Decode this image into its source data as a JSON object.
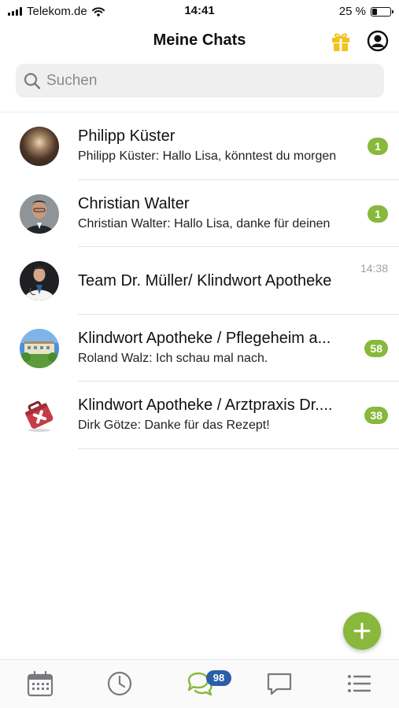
{
  "status_bar": {
    "carrier": "Telekom.de",
    "time": "14:41",
    "battery_percent_text": "25 %",
    "battery_level": 0.25
  },
  "header": {
    "title": "Meine Chats",
    "icons": [
      "gift-icon",
      "profile-icon"
    ]
  },
  "search": {
    "placeholder": "Suchen",
    "value": ""
  },
  "chats": [
    {
      "name": "Philipp Küster",
      "preview": "Philipp Küster: Hallo Lisa, könntest du morgen",
      "unread": "1",
      "avatar": "photo-dark"
    },
    {
      "name": "Christian Walter",
      "preview": "Christian Walter: Hallo Lisa, danke für deinen",
      "unread": "1",
      "avatar": "photo-man-suit"
    },
    {
      "name": "Team Dr. Müller/ Klindwort Apotheke",
      "time": "14:38",
      "avatar": "photo-doctor"
    },
    {
      "name": "Klindwort Apotheke / Pflegeheim a...",
      "preview": "Roland Walz: Ich schau mal nach.",
      "unread": "58",
      "avatar": "photo-building"
    },
    {
      "name": "Klindwort Apotheke / Arztpraxis Dr....",
      "preview": "Dirk Götze: Danke für das Rezept!",
      "unread": "38",
      "avatar": "medical-kit-icon"
    }
  ],
  "fab": {
    "icon": "plus-icon"
  },
  "tab_bar": {
    "tabs": [
      "calendar-icon",
      "clock-icon",
      "chat-bubbles-icon",
      "chat-icon",
      "list-icon"
    ],
    "chats_badge": "98"
  },
  "colors": {
    "accent_green": "#88b83c",
    "badge_blue": "#2b5ea8",
    "gift_yellow": "#f2c21a"
  }
}
